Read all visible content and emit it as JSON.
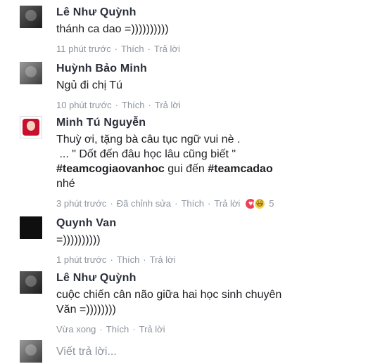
{
  "comments": [
    {
      "name": "Lê Như Quỳnh",
      "text": "thánh ca dao =))))))))))",
      "time": "11 phút trước",
      "like": "Thích",
      "reply": "Trả lời"
    },
    {
      "name": "Huỳnh Bảo Minh",
      "text": "Ngủ đi chị Tú",
      "time": "10 phút trước",
      "like": "Thích",
      "reply": "Trả lời"
    },
    {
      "name": "Minh Tú Nguyễn",
      "line1": "Thuỳ ơi, tặng bà câu tục ngữ vui nè .",
      "line2": " ... \" Dốt đến đâu học lâu cũng biết \"",
      "hashtag1": "#teamcogiaovanhoc",
      "mid": " gui đến ",
      "hashtag2": "#teamcadao",
      "line4": "nhé",
      "time": "3 phút trước",
      "edited": "Đã chỉnh sửa",
      "like": "Thích",
      "reply": "Trả lời",
      "reaction_count": "5",
      "reaction_icons": [
        "love-icon",
        "haha-icon"
      ]
    },
    {
      "name": "Quynh Van",
      "text": "=))))))))))",
      "time": "1 phút trước",
      "like": "Thích",
      "reply": "Trả lời"
    },
    {
      "name": "Lê Như Quỳnh",
      "line1": "cuộc chiến cân não giữa hai học sinh chuyên",
      "line2": "Văn =))))))))",
      "time": "Vừa xong",
      "like": "Thích",
      "reply": "Trả lời"
    }
  ],
  "reply_box": {
    "placeholder": "Viết trả lời..."
  },
  "colors": {
    "meta": "#8d949e",
    "love": "#f33e58",
    "haha": "#f7d34b"
  }
}
